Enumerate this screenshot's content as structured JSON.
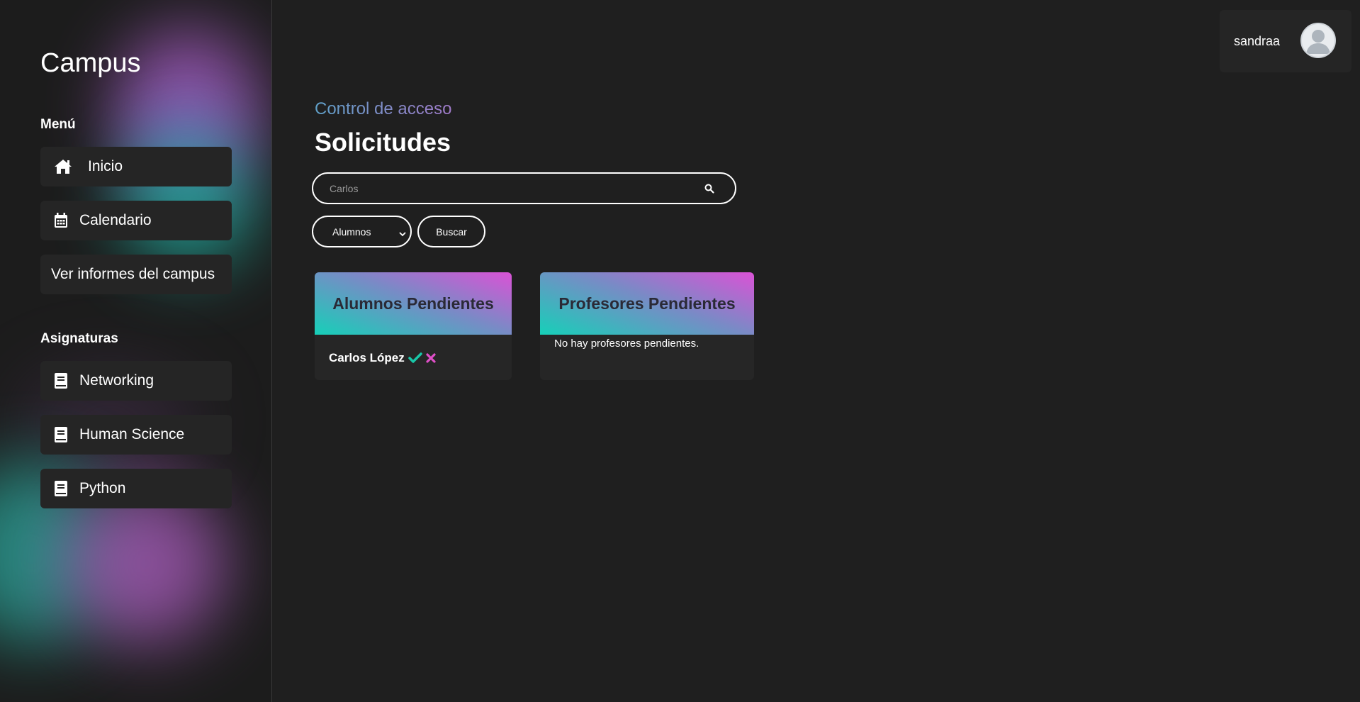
{
  "sidebar": {
    "brand": "Campus",
    "menu_label": "Menú",
    "menu_items": [
      {
        "label": "Inicio",
        "icon": "home-icon"
      },
      {
        "label": "Calendario",
        "icon": "calendar-icon"
      },
      {
        "label": "Ver informes del campus",
        "icon": ""
      }
    ],
    "subjects_label": "Asignaturas",
    "subjects": [
      {
        "label": "Networking",
        "icon": "book-icon"
      },
      {
        "label": "Human Science",
        "icon": "book-icon"
      },
      {
        "label": "Python",
        "icon": "book-icon"
      }
    ]
  },
  "user": {
    "name": "sandraa",
    "avatar_icon": "user-avatar-icon"
  },
  "main": {
    "subtitle": "Control de acceso",
    "title": "Solicitudes",
    "search": {
      "placeholder": "Carlos",
      "value": "",
      "icon": "search-icon"
    },
    "filter": {
      "selected": "Alumnos",
      "icon": "chevron-down-icon"
    },
    "search_button": "Buscar",
    "cards": {
      "students": {
        "title": "Alumnos Pendientes",
        "items": [
          {
            "name": "Carlos López",
            "approve_icon": "check-icon",
            "reject_icon": "close-icon"
          }
        ]
      },
      "teachers": {
        "title": "Profesores Pendientes",
        "empty_message": "No hay profesores pendientes."
      }
    }
  },
  "colors": {
    "background": "#1f1f1f",
    "panel": "#252525",
    "accent_teal": "#16d0b8",
    "accent_pink": "#db52d6",
    "approve": "#19c7a8",
    "reject": "#e04fc8"
  }
}
